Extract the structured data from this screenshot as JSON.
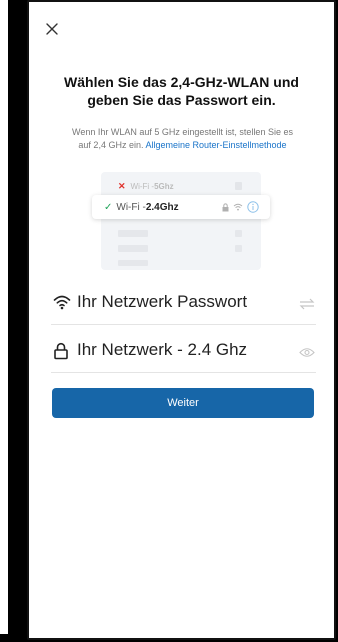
{
  "header": {
    "close_icon": "close-icon"
  },
  "title": {
    "line1": "Wählen Sie das 2,4-GHz-WLAN und",
    "line2": "geben Sie das Passwort ein."
  },
  "subtitle": {
    "line1": "Wenn Ihr WLAN auf 5 GHz eingestellt ist, stellen Sie es",
    "line2_prefix": "auf 2,4 GHz ein.",
    "link": "Allgemeine Router-Einstellmethode"
  },
  "illustration": {
    "bad_network_prefix": "Wi-Fi - ",
    "bad_network_band": "5Ghz",
    "good_network_prefix": "Wi-Fi - ",
    "good_network_band": "2.4Ghz"
  },
  "fields": {
    "password": {
      "value": "Ihr Netzwerk Passwort",
      "icon": "wifi-icon",
      "action_icon": "swap-icon"
    },
    "network": {
      "value": "Ihr Netzwerk - 2.4 Ghz",
      "icon": "lock-icon",
      "action_icon": "eye-icon"
    }
  },
  "next_button": {
    "label": "Weiter"
  },
  "colors": {
    "primary": "#1766a8",
    "link": "#1a74c9",
    "error": "#e0322d",
    "success": "#20a55a"
  }
}
